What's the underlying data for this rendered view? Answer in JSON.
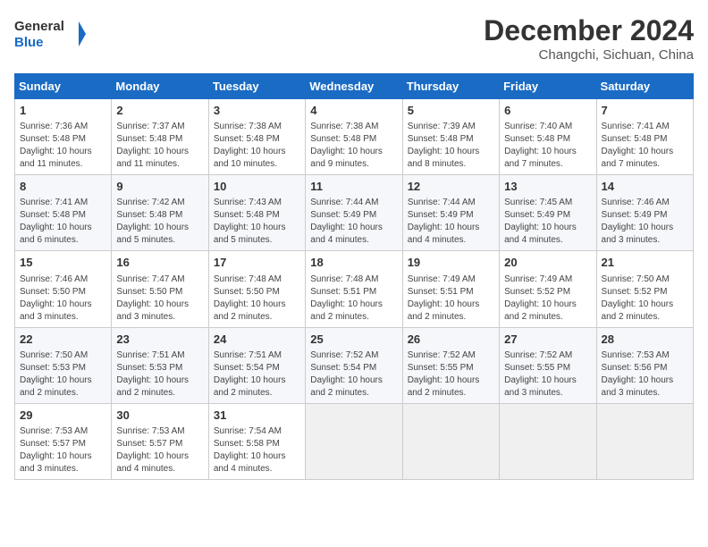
{
  "header": {
    "logo_line1": "General",
    "logo_line2": "Blue",
    "month": "December 2024",
    "location": "Changchi, Sichuan, China"
  },
  "days_of_week": [
    "Sunday",
    "Monday",
    "Tuesday",
    "Wednesday",
    "Thursday",
    "Friday",
    "Saturday"
  ],
  "weeks": [
    [
      {
        "day": "1",
        "detail": "Sunrise: 7:36 AM\nSunset: 5:48 PM\nDaylight: 10 hours\nand 11 minutes."
      },
      {
        "day": "2",
        "detail": "Sunrise: 7:37 AM\nSunset: 5:48 PM\nDaylight: 10 hours\nand 11 minutes."
      },
      {
        "day": "3",
        "detail": "Sunrise: 7:38 AM\nSunset: 5:48 PM\nDaylight: 10 hours\nand 10 minutes."
      },
      {
        "day": "4",
        "detail": "Sunrise: 7:38 AM\nSunset: 5:48 PM\nDaylight: 10 hours\nand 9 minutes."
      },
      {
        "day": "5",
        "detail": "Sunrise: 7:39 AM\nSunset: 5:48 PM\nDaylight: 10 hours\nand 8 minutes."
      },
      {
        "day": "6",
        "detail": "Sunrise: 7:40 AM\nSunset: 5:48 PM\nDaylight: 10 hours\nand 7 minutes."
      },
      {
        "day": "7",
        "detail": "Sunrise: 7:41 AM\nSunset: 5:48 PM\nDaylight: 10 hours\nand 7 minutes."
      }
    ],
    [
      {
        "day": "8",
        "detail": "Sunrise: 7:41 AM\nSunset: 5:48 PM\nDaylight: 10 hours\nand 6 minutes."
      },
      {
        "day": "9",
        "detail": "Sunrise: 7:42 AM\nSunset: 5:48 PM\nDaylight: 10 hours\nand 5 minutes."
      },
      {
        "day": "10",
        "detail": "Sunrise: 7:43 AM\nSunset: 5:48 PM\nDaylight: 10 hours\nand 5 minutes."
      },
      {
        "day": "11",
        "detail": "Sunrise: 7:44 AM\nSunset: 5:49 PM\nDaylight: 10 hours\nand 4 minutes."
      },
      {
        "day": "12",
        "detail": "Sunrise: 7:44 AM\nSunset: 5:49 PM\nDaylight: 10 hours\nand 4 minutes."
      },
      {
        "day": "13",
        "detail": "Sunrise: 7:45 AM\nSunset: 5:49 PM\nDaylight: 10 hours\nand 4 minutes."
      },
      {
        "day": "14",
        "detail": "Sunrise: 7:46 AM\nSunset: 5:49 PM\nDaylight: 10 hours\nand 3 minutes."
      }
    ],
    [
      {
        "day": "15",
        "detail": "Sunrise: 7:46 AM\nSunset: 5:50 PM\nDaylight: 10 hours\nand 3 minutes."
      },
      {
        "day": "16",
        "detail": "Sunrise: 7:47 AM\nSunset: 5:50 PM\nDaylight: 10 hours\nand 3 minutes."
      },
      {
        "day": "17",
        "detail": "Sunrise: 7:48 AM\nSunset: 5:50 PM\nDaylight: 10 hours\nand 2 minutes."
      },
      {
        "day": "18",
        "detail": "Sunrise: 7:48 AM\nSunset: 5:51 PM\nDaylight: 10 hours\nand 2 minutes."
      },
      {
        "day": "19",
        "detail": "Sunrise: 7:49 AM\nSunset: 5:51 PM\nDaylight: 10 hours\nand 2 minutes."
      },
      {
        "day": "20",
        "detail": "Sunrise: 7:49 AM\nSunset: 5:52 PM\nDaylight: 10 hours\nand 2 minutes."
      },
      {
        "day": "21",
        "detail": "Sunrise: 7:50 AM\nSunset: 5:52 PM\nDaylight: 10 hours\nand 2 minutes."
      }
    ],
    [
      {
        "day": "22",
        "detail": "Sunrise: 7:50 AM\nSunset: 5:53 PM\nDaylight: 10 hours\nand 2 minutes."
      },
      {
        "day": "23",
        "detail": "Sunrise: 7:51 AM\nSunset: 5:53 PM\nDaylight: 10 hours\nand 2 minutes."
      },
      {
        "day": "24",
        "detail": "Sunrise: 7:51 AM\nSunset: 5:54 PM\nDaylight: 10 hours\nand 2 minutes."
      },
      {
        "day": "25",
        "detail": "Sunrise: 7:52 AM\nSunset: 5:54 PM\nDaylight: 10 hours\nand 2 minutes."
      },
      {
        "day": "26",
        "detail": "Sunrise: 7:52 AM\nSunset: 5:55 PM\nDaylight: 10 hours\nand 2 minutes."
      },
      {
        "day": "27",
        "detail": "Sunrise: 7:52 AM\nSunset: 5:55 PM\nDaylight: 10 hours\nand 3 minutes."
      },
      {
        "day": "28",
        "detail": "Sunrise: 7:53 AM\nSunset: 5:56 PM\nDaylight: 10 hours\nand 3 minutes."
      }
    ],
    [
      {
        "day": "29",
        "detail": "Sunrise: 7:53 AM\nSunset: 5:57 PM\nDaylight: 10 hours\nand 3 minutes."
      },
      {
        "day": "30",
        "detail": "Sunrise: 7:53 AM\nSunset: 5:57 PM\nDaylight: 10 hours\nand 4 minutes."
      },
      {
        "day": "31",
        "detail": "Sunrise: 7:54 AM\nSunset: 5:58 PM\nDaylight: 10 hours\nand 4 minutes."
      },
      {
        "day": "",
        "detail": ""
      },
      {
        "day": "",
        "detail": ""
      },
      {
        "day": "",
        "detail": ""
      },
      {
        "day": "",
        "detail": ""
      }
    ]
  ]
}
